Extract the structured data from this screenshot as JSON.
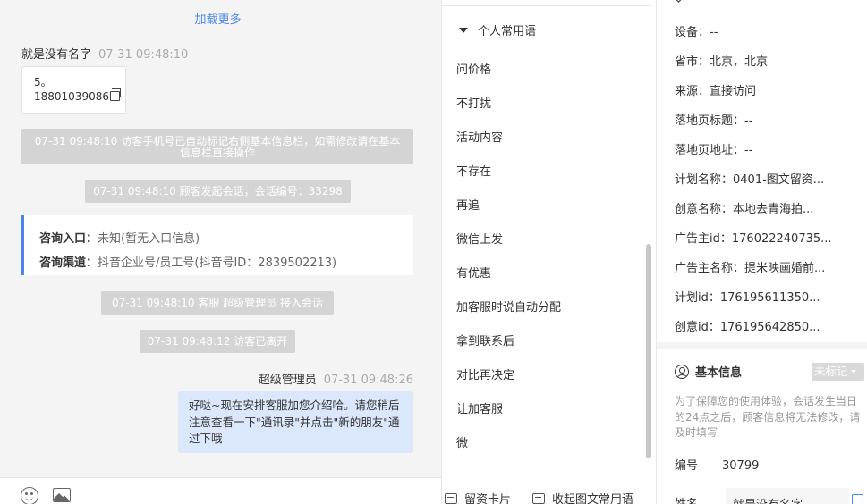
{
  "chat": {
    "load_more": "加载更多",
    "visitor_name": "就是没有名字",
    "visitor_time": "07-31 09:48:10",
    "visitor_msg_line1": "5。",
    "visitor_msg_line2": "18801039086",
    "sys_phone": "07-31 09:48:10 访客手机号已自动标记右侧基本信息栏，如需修改请在基本信息栏直接操作",
    "sys_session": "07-31 09:48:10 顾客发起会话，会话编号：33298",
    "entry_label": "咨询入口：",
    "entry_value": "未知(暂无入口信息)",
    "channel_label": "咨询渠道：",
    "channel_value": "抖音企业号/员工号(抖音号ID：2839502213)",
    "sys_join": "07-31 09:48:10 客服 超级管理员 接入会话",
    "sys_left": "07-31 09:48:12 访客已离开",
    "agent_name": "超级管理员",
    "agent_time": "07-31 09:48:26",
    "agent_msg": "好哒~现在安排客服加您介绍哈。请您稍后注意查看一下\"通讯录\"并点击\"新的朋友\"通过下哦"
  },
  "phrases": {
    "group_title": "个人常用语",
    "items": [
      "问价格",
      "不打扰",
      "活动内容",
      "不存在",
      "再追",
      "微信上发",
      "有优惠",
      "加客服时说自动分配",
      "拿到联系后",
      "对比再决定",
      "让加客服",
      "微"
    ],
    "footer_card": "留资卡片",
    "footer_collect": "收起图文常用语"
  },
  "info": {
    "fields": [
      {
        "label": "设备：",
        "value": "--"
      },
      {
        "label": "省市：",
        "value": "北京，北京"
      },
      {
        "label": "来源：",
        "value": "直接访问"
      },
      {
        "label": "落地页标题：",
        "value": "--"
      },
      {
        "label": "落地页地址：",
        "value": "--"
      },
      {
        "label": "计划名称：",
        "value": "0401-图文留资..."
      },
      {
        "label": "创意名称：",
        "value": "本地去青海拍..."
      },
      {
        "label": "广告主id：",
        "value": "176022240735..."
      },
      {
        "label": "广告主名称：",
        "value": "提米映画婚前..."
      },
      {
        "label": "计划id：",
        "value": "176195611350..."
      },
      {
        "label": "创意id：",
        "value": "176195642850..."
      }
    ],
    "basic_title": "基本信息",
    "tag_label": "未标记",
    "notice": "为了保障您的使用体验，会话发生当日的24点之后，顾客信息将无法修改，请及时填写",
    "id_label": "编号",
    "id_value": "30799",
    "name_label": "姓名",
    "name_value": "就是没有名字"
  },
  "colors": {
    "accent": "#4a86e8",
    "agent_bubble": "#dbe7fb",
    "system_msg": "#d4d4d4"
  }
}
